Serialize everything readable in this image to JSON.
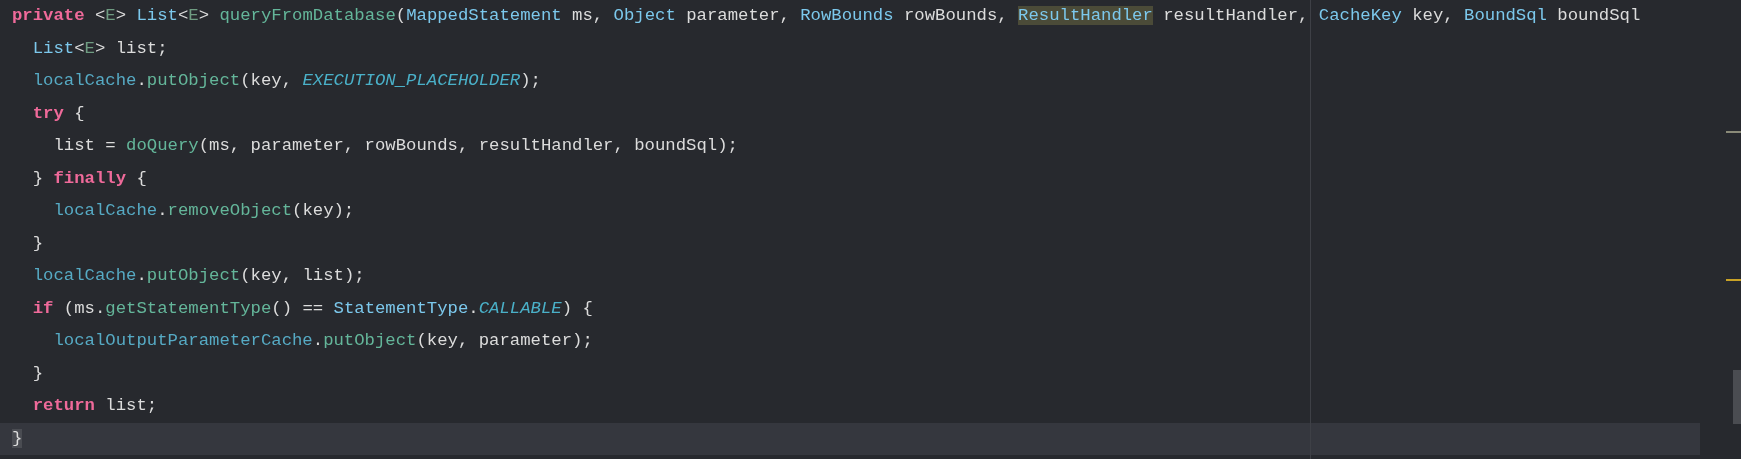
{
  "editor": {
    "lines": [
      {
        "current": false,
        "tokens": [
          {
            "kind": "keyword",
            "text": "private"
          },
          {
            "kind": "plain",
            "text": " <"
          },
          {
            "kind": "generic",
            "text": "E"
          },
          {
            "kind": "plain",
            "text": "> "
          },
          {
            "kind": "type",
            "text": "List"
          },
          {
            "kind": "plain",
            "text": "<"
          },
          {
            "kind": "generic",
            "text": "E"
          },
          {
            "kind": "plain",
            "text": "> "
          },
          {
            "kind": "method",
            "text": "queryFromDatabase"
          },
          {
            "kind": "plain",
            "text": "("
          },
          {
            "kind": "type",
            "text": "MappedStatement"
          },
          {
            "kind": "plain",
            "text": " ms, "
          },
          {
            "kind": "type",
            "text": "Object"
          },
          {
            "kind": "plain",
            "text": " parameter, "
          },
          {
            "kind": "type",
            "text": "RowBounds"
          },
          {
            "kind": "plain",
            "text": " rowBounds, "
          },
          {
            "kind": "usage",
            "text": "ResultHandler"
          },
          {
            "kind": "plain",
            "text": " resultHandler, "
          },
          {
            "kind": "type",
            "text": "CacheKey"
          },
          {
            "kind": "plain",
            "text": " key, "
          },
          {
            "kind": "type",
            "text": "BoundSql"
          },
          {
            "kind": "plain",
            "text": " boundSql"
          }
        ]
      },
      {
        "current": false,
        "tokens": [
          {
            "kind": "type",
            "text": "  List"
          },
          {
            "kind": "plain",
            "text": "<"
          },
          {
            "kind": "generic",
            "text": "E"
          },
          {
            "kind": "plain",
            "text": "> list;"
          }
        ]
      },
      {
        "current": false,
        "tokens": [
          {
            "kind": "field",
            "text": "  localCache"
          },
          {
            "kind": "plain",
            "text": "."
          },
          {
            "kind": "method",
            "text": "putObject"
          },
          {
            "kind": "plain",
            "text": "(key, "
          },
          {
            "kind": "constant",
            "text": "EXECUTION_PLACEHOLDER"
          },
          {
            "kind": "plain",
            "text": ");"
          }
        ]
      },
      {
        "current": false,
        "tokens": [
          {
            "kind": "keyword",
            "text": "  try"
          },
          {
            "kind": "plain",
            "text": " {"
          }
        ]
      },
      {
        "current": false,
        "tokens": [
          {
            "kind": "plain",
            "text": "    list = "
          },
          {
            "kind": "method",
            "text": "doQuery"
          },
          {
            "kind": "plain",
            "text": "(ms, parameter, rowBounds, resultHandler, boundSql);"
          }
        ]
      },
      {
        "current": false,
        "tokens": [
          {
            "kind": "plain",
            "text": "  } "
          },
          {
            "kind": "keyword",
            "text": "finally"
          },
          {
            "kind": "plain",
            "text": " {"
          }
        ]
      },
      {
        "current": false,
        "tokens": [
          {
            "kind": "field",
            "text": "    localCache"
          },
          {
            "kind": "plain",
            "text": "."
          },
          {
            "kind": "method",
            "text": "removeObject"
          },
          {
            "kind": "plain",
            "text": "(key);"
          }
        ]
      },
      {
        "current": false,
        "tokens": [
          {
            "kind": "plain",
            "text": "  }"
          }
        ]
      },
      {
        "current": false,
        "tokens": [
          {
            "kind": "field",
            "text": "  localCache"
          },
          {
            "kind": "plain",
            "text": "."
          },
          {
            "kind": "method",
            "text": "putObject"
          },
          {
            "kind": "plain",
            "text": "(key, list);"
          }
        ]
      },
      {
        "current": false,
        "tokens": [
          {
            "kind": "keyword",
            "text": "  if"
          },
          {
            "kind": "plain",
            "text": " (ms."
          },
          {
            "kind": "method",
            "text": "getStatementType"
          },
          {
            "kind": "plain",
            "text": "() == "
          },
          {
            "kind": "type",
            "text": "StatementType"
          },
          {
            "kind": "plain",
            "text": "."
          },
          {
            "kind": "constant",
            "text": "CALLABLE"
          },
          {
            "kind": "plain",
            "text": ") {"
          }
        ]
      },
      {
        "current": false,
        "tokens": [
          {
            "kind": "field",
            "text": "    localOutputParameterCache"
          },
          {
            "kind": "plain",
            "text": "."
          },
          {
            "kind": "method",
            "text": "putObject"
          },
          {
            "kind": "plain",
            "text": "(key, parameter);"
          }
        ]
      },
      {
        "current": false,
        "tokens": [
          {
            "kind": "plain",
            "text": "  }"
          }
        ]
      },
      {
        "current": false,
        "tokens": [
          {
            "kind": "keyword",
            "text": "  return"
          },
          {
            "kind": "plain",
            "text": " list;"
          }
        ]
      },
      {
        "current": true,
        "tokens": [
          {
            "kind": "brace-match",
            "text": "}"
          }
        ]
      }
    ]
  }
}
